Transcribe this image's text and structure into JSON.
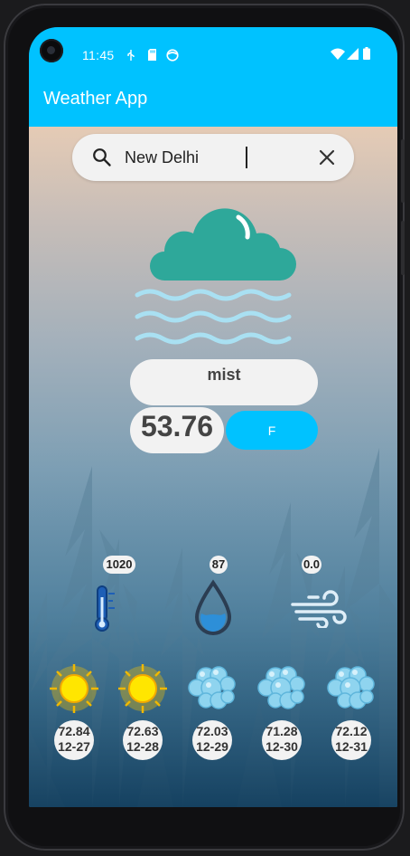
{
  "status_bar": {
    "time": "11:45"
  },
  "app_bar": {
    "title": "Weather App"
  },
  "search": {
    "value": "New Delhi"
  },
  "current": {
    "description": "mist",
    "temperature": "53.76",
    "unit_button": "F"
  },
  "stats": {
    "pressure": "1020",
    "humidity": "87",
    "wind": "0.0"
  },
  "forecast": [
    {
      "temp": "72.84",
      "date": "12-27",
      "icon": "sun-icon"
    },
    {
      "temp": "72.63",
      "date": "12-28",
      "icon": "sun-icon"
    },
    {
      "temp": "72.03",
      "date": "12-29",
      "icon": "clouds-icon"
    },
    {
      "temp": "71.28",
      "date": "12-30",
      "icon": "clouds-icon"
    },
    {
      "temp": "72.12",
      "date": "12-31",
      "icon": "clouds-icon"
    }
  ],
  "colors": {
    "accent": "#00c2ff",
    "pill": "#f2f2f2",
    "cloud": "#2ea89a",
    "mist_lines": "#a9e0f2"
  }
}
